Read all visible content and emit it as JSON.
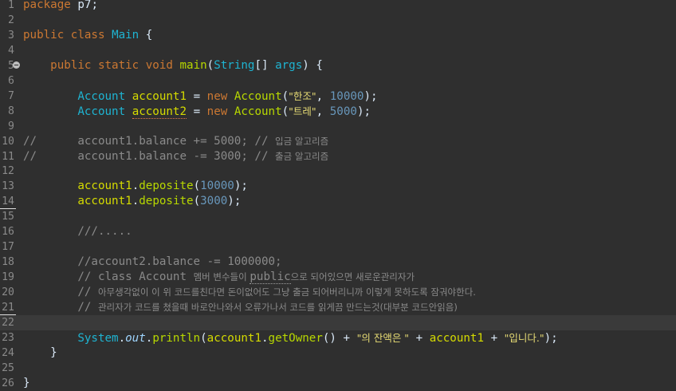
{
  "lines": [
    {
      "num": "1",
      "code": "package p7;"
    },
    {
      "num": "2",
      "code": ""
    },
    {
      "num": "3",
      "code": "public class Main {"
    },
    {
      "num": "4",
      "code": ""
    },
    {
      "num": "5",
      "code": "    public static void main(String[] args) {"
    },
    {
      "num": "6",
      "code": ""
    },
    {
      "num": "7",
      "code": "        Account account1 = new Account(\"한조\", 10000);"
    },
    {
      "num": "8",
      "code": "        Account account2 = new Account(\"트레\", 5000);"
    },
    {
      "num": "9",
      "code": ""
    },
    {
      "num": "10",
      "code": "//      account1.balance += 5000; // 입금 알고리즘"
    },
    {
      "num": "11",
      "code": "//      account1.balance -= 3000; // 출금 알고리즘"
    },
    {
      "num": "12",
      "code": ""
    },
    {
      "num": "13",
      "code": "        account1.deposite(10000);"
    },
    {
      "num": "14",
      "code": "        account1.deposite(3000);"
    },
    {
      "num": "15",
      "code": ""
    },
    {
      "num": "16",
      "code": "        ///....."
    },
    {
      "num": "17",
      "code": ""
    },
    {
      "num": "18",
      "code": "        //account2.balance -= 1000000;"
    },
    {
      "num": "19",
      "code": "        // class Account 멤버 변수들이 public으로 되어있으면 새로운관리자가"
    },
    {
      "num": "20",
      "code": "        // 아무생각없이 이 위 코드를친다면 돈이없어도 그냥 출금 되어버리니까 이렇게 못하도록 잠궈야한다."
    },
    {
      "num": "21",
      "code": "        // 관리자가 코드를 쳤을때 바로안나와서 오류가나서 코드를 읽게끔 만드는것(대부분 코드안읽음)"
    },
    {
      "num": "22",
      "code": ""
    },
    {
      "num": "23",
      "code": "        System.out.println(account1.getOwner() + \"의 잔액은 \" + account1 + \"입니다.\");"
    },
    {
      "num": "24",
      "code": "    }"
    },
    {
      "num": "25",
      "code": ""
    },
    {
      "num": "26",
      "code": "}"
    }
  ],
  "colors": {
    "background": "#2f2f2f",
    "current_line": "#3a3a3a",
    "line_number": "#8a8a8a",
    "keyword": "#cc7832",
    "class_name": "#1eb4d2",
    "method": "#b8d800",
    "variable": "#d5db00",
    "string": "#e6db74",
    "number": "#6897bb",
    "comment": "#8a8a8a",
    "plain": "#d9e8f7"
  },
  "icons": {
    "fold_marker_line5": "collapse-minus-icon"
  }
}
